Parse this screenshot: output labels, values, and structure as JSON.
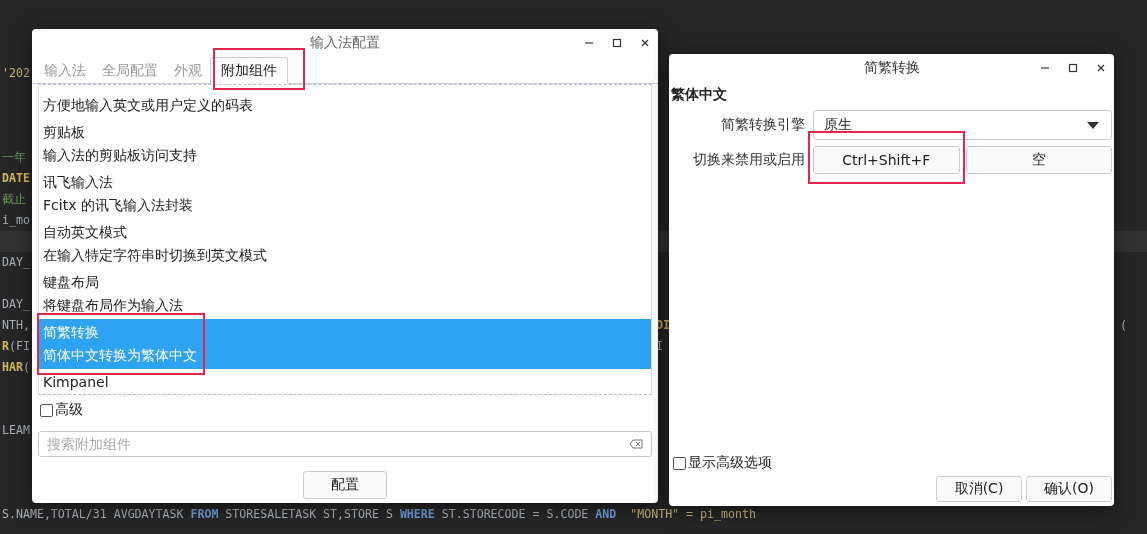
{
  "editor": {
    "lines": [
      {
        "current": false,
        "segments": [
          {
            "text": "'202",
            "kind": "string"
          }
        ]
      },
      {
        "current": false
      },
      {
        "current": false
      },
      {
        "current": false
      },
      {
        "current": false,
        "segments": [
          {
            "text": "一年",
            "kind": "comment"
          }
        ]
      },
      {
        "current": false,
        "segments": [
          {
            "text": "DATE",
            "kind": "function"
          }
        ]
      },
      {
        "current": false,
        "segments": [
          {
            "text": "截止",
            "kind": "comment"
          }
        ]
      },
      {
        "current": false,
        "segments": [
          {
            "text": "i_mo",
            "kind": "plain"
          }
        ]
      },
      {
        "current": true
      },
      {
        "current": false,
        "segments": [
          {
            "text": "DAY_",
            "kind": "plain"
          }
        ]
      },
      {
        "current": false
      },
      {
        "current": false,
        "segments": [
          {
            "text": "DAY_",
            "kind": "plain"
          }
        ]
      },
      {
        "current": false,
        "segments": [
          {
            "text": "NTH,",
            "kind": "plain"
          }
        ],
        "mid": {
          "text": "OI",
          "kind": "function"
        },
        "end": {
          "text": "(",
          "kind": "plain"
        }
      },
      {
        "current": false,
        "segments": [
          {
            "text": "R",
            "kind": "function"
          },
          {
            "text": "(FI",
            "kind": "plain"
          }
        ],
        "mid": {
          "text": "I",
          "kind": "plain"
        }
      },
      {
        "current": false,
        "segments": [
          {
            "text": "HAR",
            "kind": "function"
          },
          {
            "text": "(",
            "kind": "plain"
          }
        ]
      },
      {
        "current": false
      },
      {
        "current": false
      },
      {
        "current": false,
        "segments": [
          {
            "text": "LEAM",
            "kind": "plain"
          }
        ]
      },
      {
        "current": false
      },
      {
        "current": false
      },
      {
        "current": false
      },
      {
        "current": false,
        "segments": [
          {
            "text": "S.NAME,TOTAL/31 AVGDAYTASK ",
            "kind": "plain"
          },
          {
            "text": "FROM",
            "kind": "keyword"
          },
          {
            "text": " STORESALETASK ST,STORE S ",
            "kind": "plain"
          },
          {
            "text": "WHERE",
            "kind": "keyword"
          },
          {
            "text": " ST.STORECODE = S.CODE ",
            "kind": "plain"
          },
          {
            "text": "AND",
            "kind": "keyword"
          },
          {
            "text": "  \"MONTH\" = pi_month",
            "kind": "string"
          }
        ]
      }
    ]
  },
  "config_window": {
    "title": "输入法配置",
    "tabs": [
      {
        "label": "输入法",
        "selected": false
      },
      {
        "label": "全局配置",
        "selected": false
      },
      {
        "label": "外观",
        "selected": false
      },
      {
        "label": "附加组件",
        "selected": true
      }
    ],
    "addons": [
      {
        "description": "方便地输入英文或用户定义的码表",
        "selected": false
      },
      {
        "name": "剪贴板",
        "description": "输入法的剪贴板访问支持",
        "selected": false
      },
      {
        "name": "讯飞输入法",
        "description": "Fcitx 的讯飞输入法封装",
        "selected": false
      },
      {
        "name": "自动英文模式",
        "description": "在输入特定字符串时切换到英文模式",
        "selected": false
      },
      {
        "name": "键盘布局",
        "description": "将键盘布局作为输入法",
        "selected": false
      },
      {
        "name": "简繁转换",
        "description": "简体中文转换为繁体中文",
        "selected": true
      },
      {
        "name": "Kimpanel",
        "selected": false
      }
    ],
    "advanced": {
      "label": "高级",
      "checked": false
    },
    "search": {
      "placeholder": "搜索附加组件"
    },
    "configure_button": "配置"
  },
  "addon_window": {
    "title": "简繁转换",
    "section": "繁体中文",
    "engine": {
      "label": "简繁转换引擎",
      "value": "原生"
    },
    "toggle": {
      "label": "切换来禁用或启用",
      "keys": [
        "Ctrl+Shift+F",
        "空"
      ]
    },
    "show_advanced": {
      "label": "显示高级选项",
      "checked": false
    },
    "buttons": [
      "取消(C)",
      "确认(O)"
    ]
  }
}
